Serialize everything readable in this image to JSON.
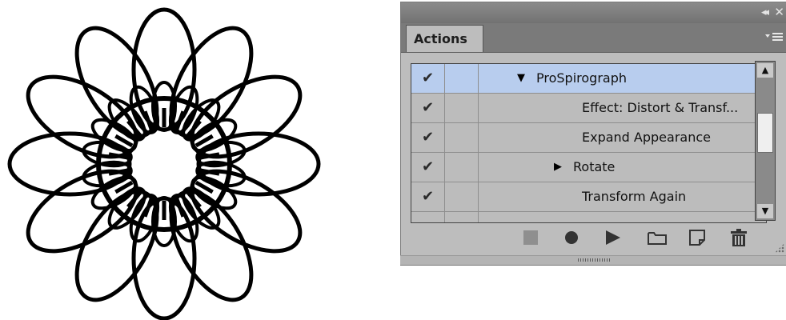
{
  "panel": {
    "collapse_glyph": "◂◂",
    "close_glyph": "✕",
    "tab_label": "Actions"
  },
  "actions": [
    {
      "label": "ProSpirograph",
      "checked": true,
      "expander": "open",
      "selected": true
    },
    {
      "label": "Effect: Distort & Transf...",
      "checked": true,
      "expander": "none",
      "selected": false
    },
    {
      "label": "Expand Appearance",
      "checked": true,
      "expander": "none",
      "selected": false
    },
    {
      "label": "Rotate",
      "checked": true,
      "expander": "closed",
      "selected": false
    },
    {
      "label": "Transform Again",
      "checked": true,
      "expander": "none",
      "selected": false
    }
  ],
  "toolbar": [
    "stop-icon",
    "record-icon",
    "play-icon",
    "new-set-folder-icon",
    "new-action-icon",
    "delete-icon"
  ],
  "colors": {
    "selected_row": "#b8cdee",
    "panel_bg": "#bdbdbd",
    "stop_disabled": "#8f8f8f",
    "icon_dark": "#333333"
  }
}
